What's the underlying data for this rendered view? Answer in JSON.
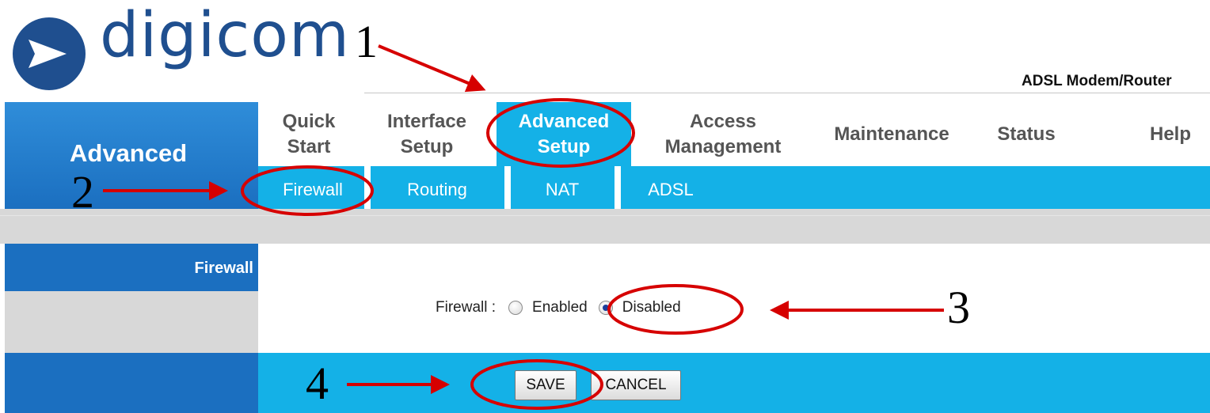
{
  "brand": {
    "logo_text": "digicom",
    "product_name": "ADSL Modem/Router",
    "colors": {
      "logo_blue": "#1f4f8f",
      "nav_blue": "#1b6fc0",
      "accent_cyan": "#14b1e7",
      "annotation_red": "#d60000"
    }
  },
  "section_title": "Advanced",
  "nav": {
    "items": [
      {
        "label": "Quick\nStart",
        "active": false
      },
      {
        "label": "Interface\nSetup",
        "active": false
      },
      {
        "label": "Advanced\nSetup",
        "active": true
      },
      {
        "label": "Access\nManagement",
        "active": false
      },
      {
        "label": "Maintenance",
        "active": false
      },
      {
        "label": "Status",
        "active": false
      },
      {
        "label": "Help",
        "active": false
      }
    ]
  },
  "subnav": {
    "items": [
      {
        "label": "Firewall",
        "active": true
      },
      {
        "label": "Routing",
        "active": false
      },
      {
        "label": "NAT",
        "active": false
      },
      {
        "label": "ADSL",
        "active": false
      }
    ]
  },
  "panel": {
    "left_label": "Firewall",
    "field_label": "Firewall :",
    "options": [
      {
        "label": "Enabled",
        "checked": false
      },
      {
        "label": "Disabled",
        "checked": true
      }
    ]
  },
  "buttons": {
    "save": "SAVE",
    "cancel": "CANCEL"
  },
  "annotations": {
    "step1": "1",
    "step2": "2",
    "step3": "3",
    "step4": "4"
  }
}
